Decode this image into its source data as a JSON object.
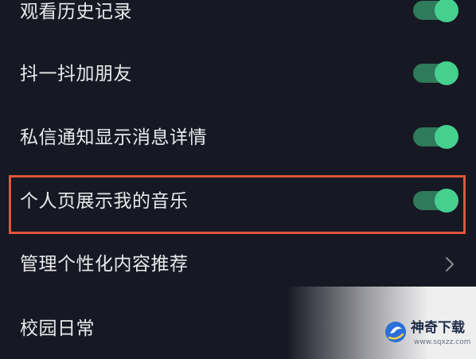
{
  "settings": {
    "items": [
      {
        "label": "观看历史记录",
        "control": "toggle",
        "on": true
      },
      {
        "label": "抖一抖加朋友",
        "control": "toggle",
        "on": true
      },
      {
        "label": "私信通知显示消息详情",
        "control": "toggle",
        "on": true
      },
      {
        "label": "个人页展示我的音乐",
        "control": "toggle",
        "on": true,
        "highlighted": true
      },
      {
        "label": "管理个性化内容推荐",
        "control": "chevron-right-icon"
      },
      {
        "label": "校园日常",
        "control": "none"
      }
    ]
  },
  "colors": {
    "background": "#161823",
    "toggle_track_on": "#2f7a5a",
    "toggle_knob_on": "#45d08e",
    "highlight_border": "#e0553c"
  },
  "watermark": {
    "title": "神奇下载",
    "url": "www.sqxzz.com",
    "icon": "shenqi-logo-icon"
  }
}
